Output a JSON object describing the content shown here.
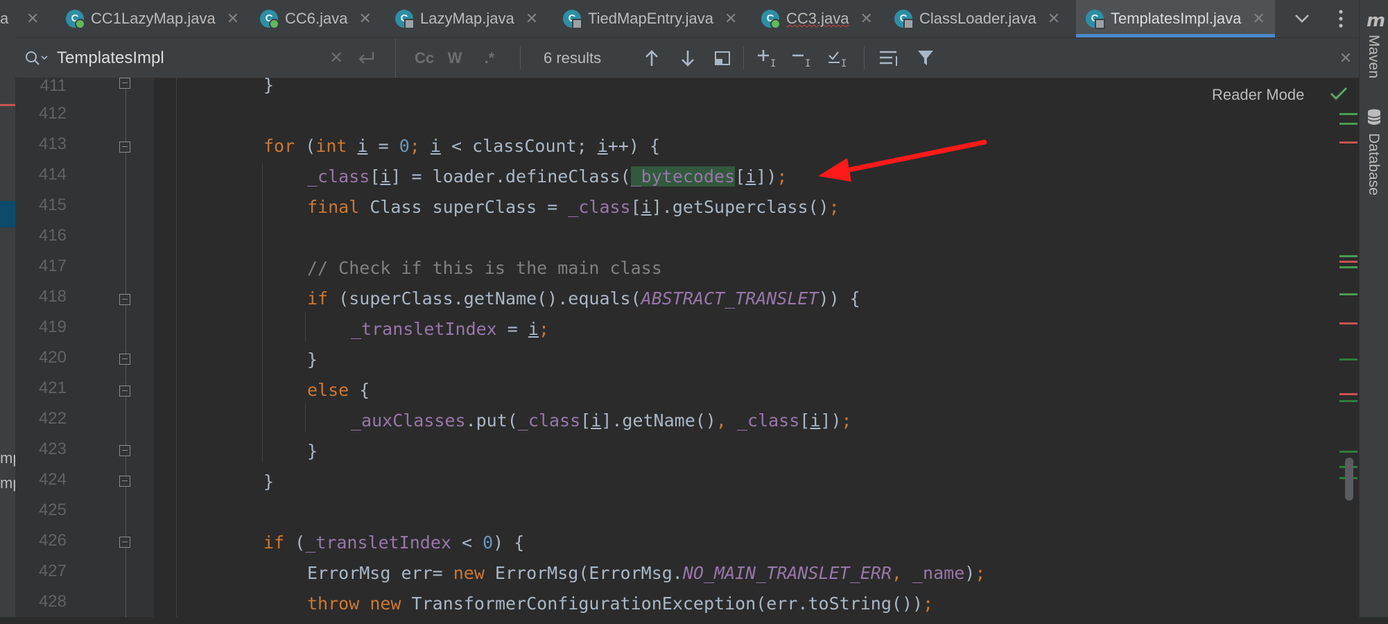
{
  "left_strip": {
    "fragments": [
      "a",
      "mp",
      "mp"
    ]
  },
  "tabs": [
    {
      "label": "CC1LazyMap.java",
      "icon": "class-icon",
      "active": false
    },
    {
      "label": "CC6.java",
      "icon": "class-icon",
      "active": false
    },
    {
      "label": "LazyMap.java",
      "icon": "class-locked-icon",
      "active": false
    },
    {
      "label": "TiedMapEntry.java",
      "icon": "class-locked-icon",
      "active": false
    },
    {
      "label": "CC3.java",
      "icon": "class-icon",
      "active": false
    },
    {
      "label": "ClassLoader.java",
      "icon": "class-locked-icon",
      "active": false
    },
    {
      "label": "TemplatesImpl.java",
      "icon": "class-locked-icon",
      "active": true
    }
  ],
  "search": {
    "value": "TemplatesImpl",
    "results": "6 results",
    "match_case": "Cc",
    "words": "W",
    "regex": ".*"
  },
  "editor": {
    "reader_mode": "Reader Mode",
    "line_numbers": [
      "411",
      "412",
      "413",
      "414",
      "415",
      "416",
      "417",
      "418",
      "419",
      "420",
      "421",
      "422",
      "423",
      "424",
      "425",
      "426",
      "427",
      "428"
    ]
  },
  "code": {
    "l411": {
      "t1": "}"
    },
    "l413": {
      "t1": "for",
      "t2": " (",
      "t3": "int",
      "t4": " ",
      "t5": "i",
      "t6": " = ",
      "t7": "0",
      "t8": "; ",
      "t9": "i",
      "t10": " < classCount; ",
      "t11": "i",
      "t12": "++) {"
    },
    "l414": {
      "t1": "_class",
      "t2": "[",
      "t3": "i",
      "t4": "] = loader.defineClass(",
      "t5": "_bytecodes",
      "t6": "[",
      "t7": "i",
      "t8": "])",
      "t9": ";"
    },
    "l415": {
      "t1": "final",
      "t2": " Class superClass = ",
      "t3": "_class",
      "t4": "[",
      "t5": "i",
      "t6": "].getSuperclass()",
      "t7": ";"
    },
    "l417": {
      "t1": "// Check if this is the main class"
    },
    "l418": {
      "t1": "if",
      "t2": " (superClass.getName().equals(",
      "t3": "ABSTRACT_TRANSLET",
      "t4": ")) {"
    },
    "l419": {
      "t1": "_transletIndex",
      "t2": " = ",
      "t3": "i",
      "t4": ";"
    },
    "l420": {
      "t1": "}"
    },
    "l421": {
      "t1": "else",
      "t2": " {"
    },
    "l422": {
      "t1": "_auxClasses",
      "t2": ".put(",
      "t3": "_class",
      "t4": "[",
      "t5": "i",
      "t6": "].getName()",
      "t7": ", ",
      "t8": "_class",
      "t9": "[",
      "t10": "i",
      "t11": "])",
      "t12": ";"
    },
    "l423": {
      "t1": "}"
    },
    "l424": {
      "t1": "}"
    },
    "l426": {
      "t1": "if",
      "t2": " (",
      "t3": "_transletIndex",
      "t4": " < ",
      "t5": "0",
      "t6": ") {"
    },
    "l427": {
      "t1": "ErrorMsg err= ",
      "t2": "new",
      "t3": " ErrorMsg(ErrorMsg.",
      "t4": "NO_MAIN_TRANSLET_ERR",
      "t5": ", ",
      "t6": "_name",
      "t7": ")",
      "t8": ";"
    },
    "l428": {
      "t1": "throw",
      "t2": " ",
      "t3": "new",
      "t4": " TransformerConfigurationException(err.toString())",
      "t5": ";"
    }
  },
  "right_tools": {
    "maven": "Maven",
    "database": "Database"
  },
  "colors": {
    "keyword": "#cc7832",
    "field": "#9876aa",
    "number": "#6897bb",
    "comment": "#808080",
    "annotation_arrow": "#ff1a1a",
    "accent": "#4a88c7"
  }
}
